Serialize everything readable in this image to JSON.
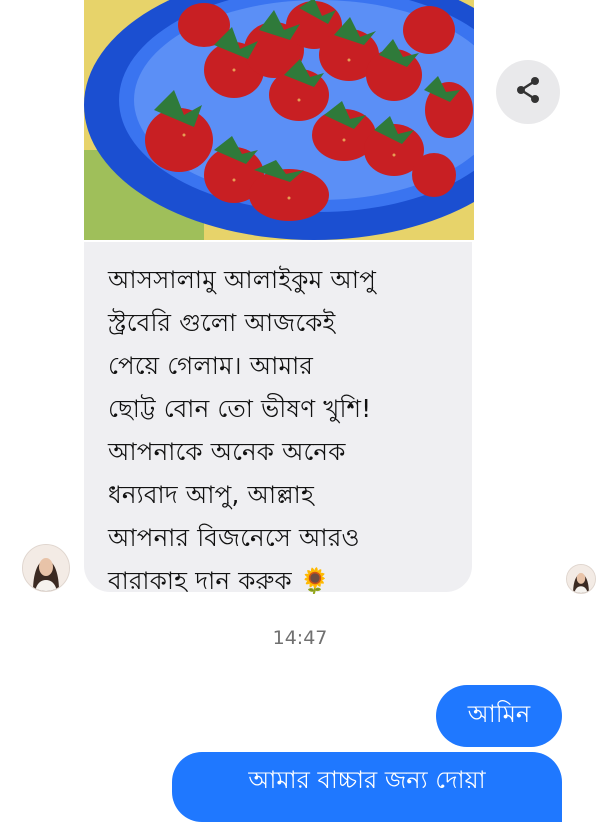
{
  "conversation": {
    "incoming": {
      "text": "আসসালামু আলাইকুম আপু\nস্ট্রবেরি গুলো আজকেই\nপেয়ে গেলাম। আমার\nছোট্ট বোন তো ভীষণ খুশি!\nআপনাকে অনেক অনেক\nধন্যবাদ আপু, আল্লাহ\nআপনার বিজনেসে আরও\nবারাকাহ দান করুক 🌻",
      "image_icon": "strawberries-photo"
    },
    "share_icon": "share-icon",
    "timestamp": "14:47",
    "outgoing": [
      {
        "text": "আমিন"
      },
      {
        "text": "আমার বাচ্চার জন্য দোয়া"
      }
    ]
  },
  "colors": {
    "outgoing_bubble": "#1f78ff",
    "incoming_bubble": "#efeff2",
    "timestamp": "#707070"
  }
}
